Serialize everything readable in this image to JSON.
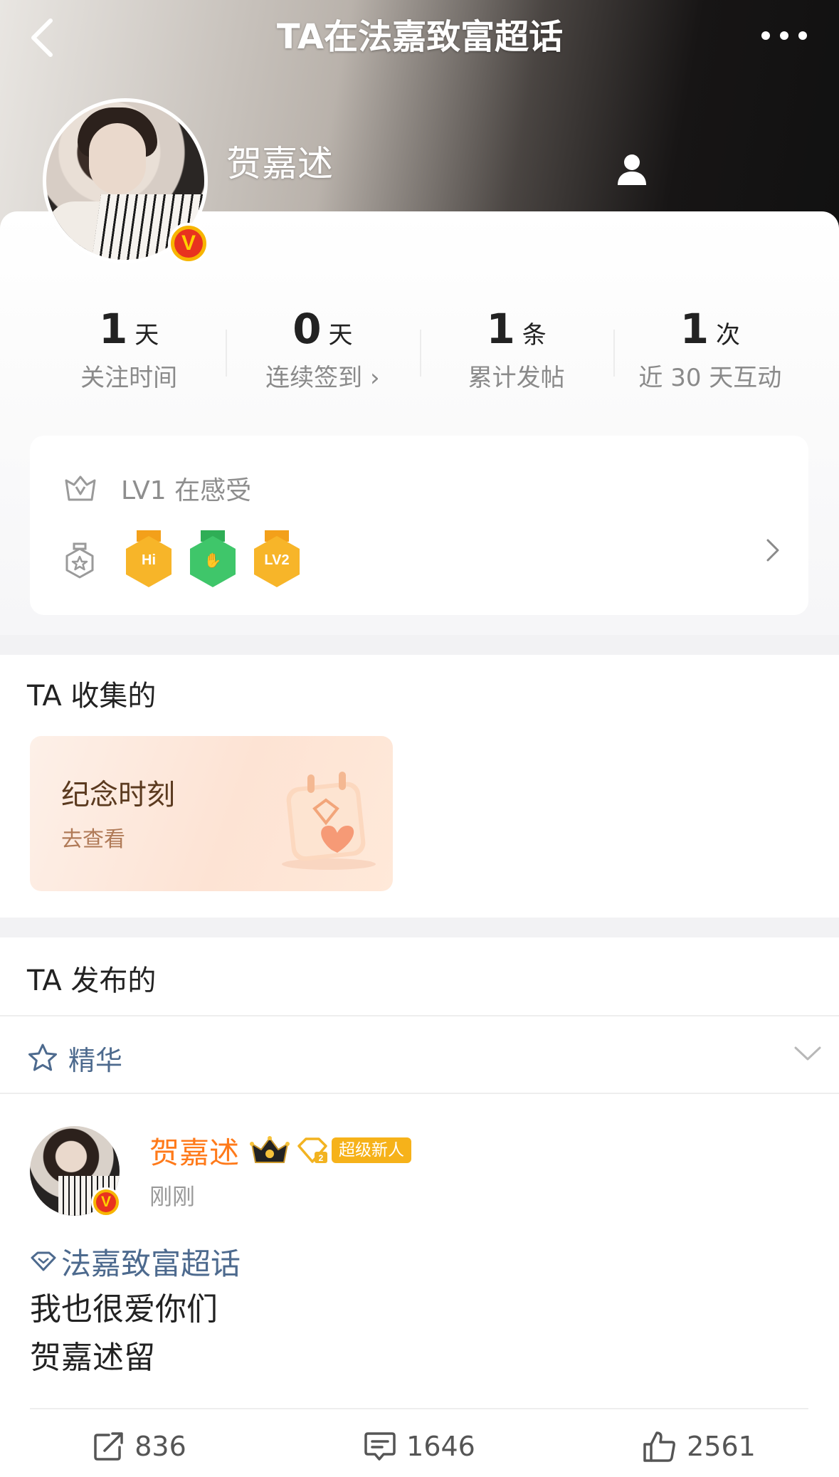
{
  "header": {
    "title": "TA在法嘉致富超话",
    "back_icon": "back-icon",
    "more_icon": "more-icon"
  },
  "profile": {
    "name": "贺嘉述",
    "verified_badge": "V",
    "avatar_icon": "avatar",
    "person_icon": "person-icon"
  },
  "stats": [
    {
      "value": "1",
      "unit": "天",
      "label": "关注时间"
    },
    {
      "value": "0",
      "unit": "天",
      "label": "连续签到 ›"
    },
    {
      "value": "1",
      "unit": "条",
      "label": "累计发帖"
    },
    {
      "value": "1",
      "unit": "次",
      "label": "近 30 天互动"
    }
  ],
  "level": {
    "text": "LV1 在感受",
    "medals": [
      {
        "label": "Hi",
        "color": "#f7b529"
      },
      {
        "label": "✋",
        "color": "#3fc66a"
      },
      {
        "label": "LV2",
        "color": "#f7b529"
      }
    ]
  },
  "collected": {
    "section_title": "TA 收集的",
    "card_title": "纪念时刻",
    "card_sub": "去查看"
  },
  "posts": {
    "section_title": "TA 发布的",
    "filter_label": "精华",
    "post": {
      "author": "贺嘉述",
      "badge": "超级新人",
      "time": "刚刚",
      "topic": "法嘉致富超话",
      "lines": [
        "我也很爱你们",
        "贺嘉述留"
      ],
      "reposts": "836",
      "comments": "1646",
      "likes": "2561"
    }
  },
  "colors": {
    "accent_orange": "#ff7a1a",
    "link_blue": "#4d6a8e",
    "badge_gold": "#f6b21a"
  }
}
